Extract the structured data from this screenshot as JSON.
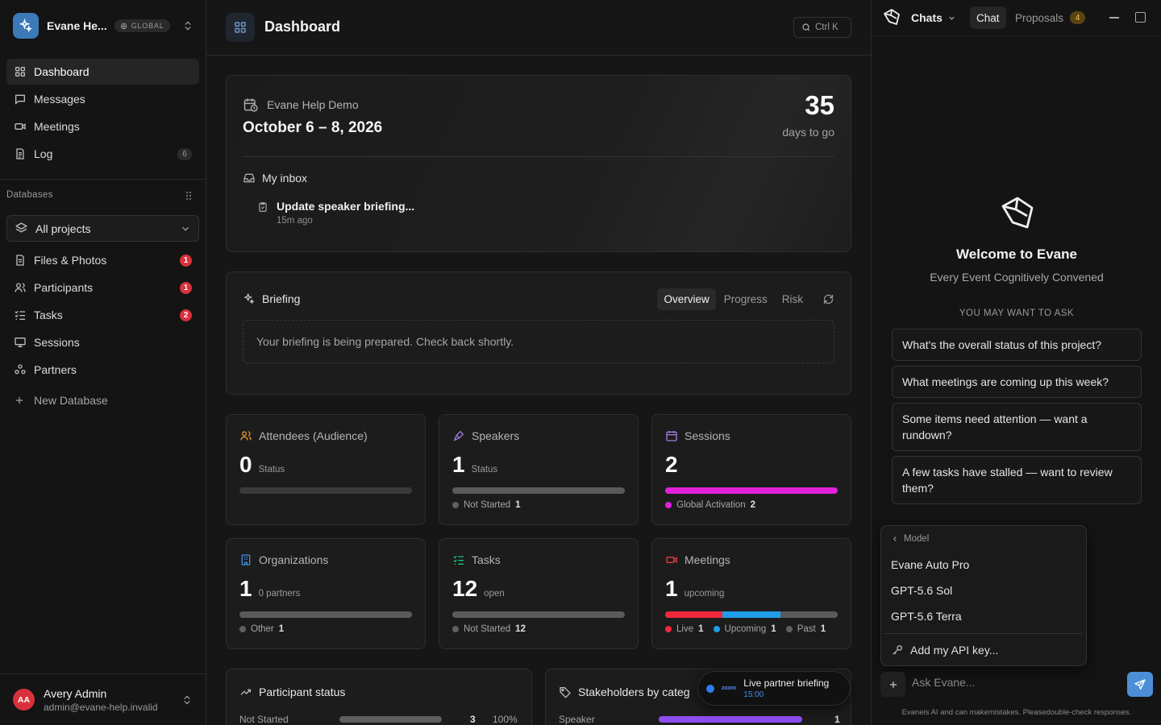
{
  "workspace": {
    "name": "Evane He...",
    "badge": "GLOBAL"
  },
  "nav": [
    {
      "label": "Dashboard",
      "icon": "dashboard-icon"
    },
    {
      "label": "Messages",
      "icon": "message-icon"
    },
    {
      "label": "Meetings",
      "icon": "video-icon"
    },
    {
      "label": "Log",
      "icon": "log-icon",
      "count": "6"
    }
  ],
  "databases": {
    "label": "Databases",
    "selector": "All projects",
    "items": [
      {
        "label": "Files & Photos",
        "badge": "1"
      },
      {
        "label": "Participants",
        "badge": "1"
      },
      {
        "label": "Tasks",
        "badge": "2"
      },
      {
        "label": "Sessions"
      },
      {
        "label": "Partners"
      }
    ],
    "new_label": "New Database"
  },
  "user": {
    "initials": "AA",
    "name": "Avery Admin",
    "email": "admin@evane-help.invalid"
  },
  "header": {
    "title": "Dashboard",
    "shortcut": "Ctrl K"
  },
  "event": {
    "name": "Evane Help Demo",
    "dates": "October 6 – 8, 2026",
    "days": "35",
    "days_label": "days to go"
  },
  "inbox": {
    "title": "My inbox",
    "item": "Update speaker briefing...",
    "time": "15m ago"
  },
  "briefing": {
    "title": "Briefing",
    "tabs": [
      "Overview",
      "Progress",
      "Risk"
    ],
    "active_tab": "Overview",
    "message": "Your briefing is being prepared. Check back shortly."
  },
  "stats": [
    {
      "title": "Attendees (Audience)",
      "value": "0",
      "sub": "Status",
      "color": "#e89a2c",
      "segments": [],
      "legend": []
    },
    {
      "title": "Speakers",
      "value": "1",
      "sub": "Status",
      "color": "#a07de0",
      "segments": [
        {
          "color": "#5a5a5a",
          "fraction": 1
        }
      ],
      "legend": [
        {
          "label": "Not Started",
          "count": "1",
          "color": "#5f5f5f"
        }
      ]
    },
    {
      "title": "Sessions",
      "value": "2",
      "sub": "",
      "color": "#a07de0",
      "segments": [
        {
          "color": "#e021d8",
          "fraction": 1
        }
      ],
      "legend": [
        {
          "label": "Global Activation",
          "count": "2",
          "color": "#e021d8"
        }
      ]
    },
    {
      "title": "Organizations",
      "value": "1",
      "sub": "0 partners",
      "color": "#3d8fe0",
      "segments": [
        {
          "color": "#5a5a5a",
          "fraction": 1
        }
      ],
      "legend": [
        {
          "label": "Other",
          "count": "1",
          "color": "#5f5f5f"
        }
      ]
    },
    {
      "title": "Tasks",
      "value": "12",
      "sub": "open",
      "color": "#22c07a",
      "segments": [
        {
          "color": "#5a5a5a",
          "fraction": 1
        }
      ],
      "legend": [
        {
          "label": "Not Started",
          "count": "12",
          "color": "#5f5f5f"
        }
      ]
    },
    {
      "title": "Meetings",
      "value": "1",
      "sub": "upcoming",
      "color": "#e8394a",
      "segments": [
        {
          "color": "#f0283c",
          "fraction": 0.333
        },
        {
          "color": "#1f9de8",
          "fraction": 0.333
        },
        {
          "color": "#5a5a5a",
          "fraction": 0.334
        }
      ],
      "legend": [
        {
          "label": "Live",
          "count": "1",
          "color": "#f0283c"
        },
        {
          "label": "Upcoming",
          "count": "1",
          "color": "#1f9de8"
        },
        {
          "label": "Past",
          "count": "1",
          "color": "#5f5f5f"
        }
      ]
    }
  ],
  "participant_status": {
    "title": "Participant status",
    "row": {
      "label": "Not Started",
      "value": "3",
      "percent": "100%",
      "fraction": 1
    }
  },
  "stakeholders": {
    "title": "Stakeholders by categ",
    "row": {
      "label": "Speaker",
      "value": "1",
      "fraction": 1
    }
  },
  "toast": {
    "title": "Live partner briefing",
    "time": "15:00",
    "app": "zoom"
  },
  "chat": {
    "header": "Chats",
    "tab_chat": "Chat",
    "tab_proposals": "Proposals",
    "proposals_count": "4",
    "welcome": "Welcome to Evane",
    "tagline": "Every Event Cognitively Convened",
    "ask_label": "YOU MAY WANT TO ASK",
    "suggestions": [
      "What's the overall status of this project?",
      "What meetings are coming up this week?",
      "Some items need attention — want a rundown?",
      "A few tasks have stalled — want to review them?"
    ],
    "model_label": "Model",
    "models": [
      "Evane Auto Pro",
      "GPT-5.6 Sol",
      "GPT-5.6 Terra"
    ],
    "api_key": "Add my API key...",
    "placeholder": "Ask Evane...",
    "disclaimer": "Evaneis AI and can makemistakes. Pleasedouble-check responses."
  },
  "colors": {
    "accent": "#3b7ab8",
    "danger": "#d8313b",
    "send": "#4d8fd6"
  }
}
